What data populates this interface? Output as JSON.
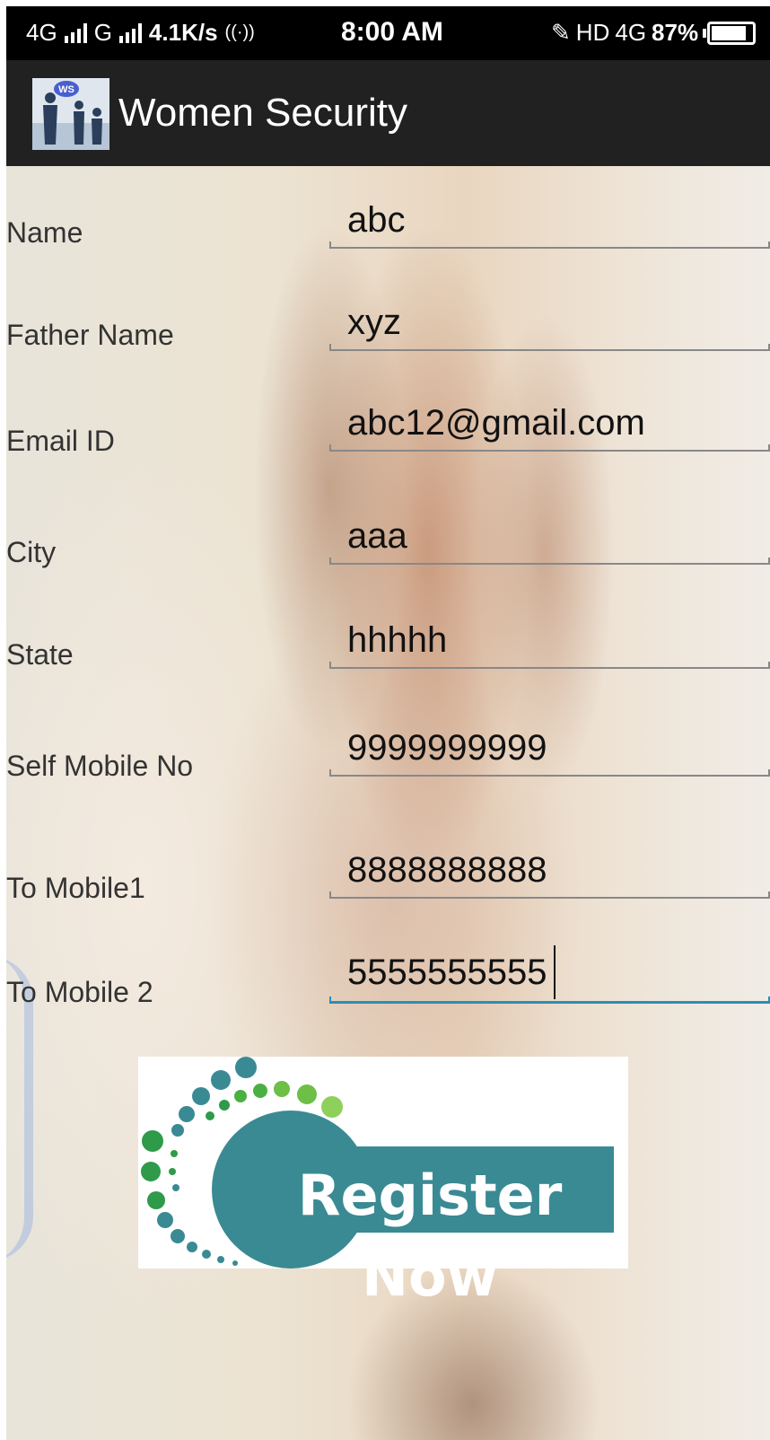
{
  "status_bar": {
    "net1": "4G",
    "net2": "G",
    "speed": "4.1K/s",
    "time": "8:00 AM",
    "hd": "HD",
    "net3": "4G",
    "battery": "87%",
    "battery_level": 0.87
  },
  "app_bar": {
    "logo_text": "WS",
    "title": "Women Security"
  },
  "form": {
    "fields": [
      {
        "label": "Name",
        "value": "abc"
      },
      {
        "label": "Father Name",
        "value": "xyz"
      },
      {
        "label": "Email ID",
        "value": "abc12@gmail.com"
      },
      {
        "label": "City",
        "value": "aaa"
      },
      {
        "label": "State",
        "value": "hhhhh"
      },
      {
        "label": "Self Mobile No",
        "value": "9999999999"
      },
      {
        "label": "To Mobile1",
        "value": "8888888888"
      },
      {
        "label": "To Mobile 2",
        "value": "5555555555"
      }
    ]
  },
  "register_button": {
    "label": "Register Now"
  },
  "colors": {
    "accent": "#2a8fb5",
    "status_bar": "#000000",
    "app_bar": "#212121",
    "register_teal": "#3a8a94",
    "register_green": "#6dbf45"
  }
}
